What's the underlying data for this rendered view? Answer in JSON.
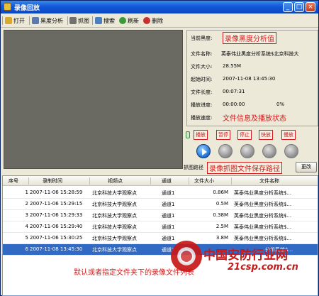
{
  "window": {
    "title": "录像回放",
    "buttons": {
      "minimize": "_",
      "maximize": "□",
      "close": "×"
    }
  },
  "toolbar": {
    "items": [
      {
        "label": "打开",
        "icon": "folder-open-icon",
        "color": "#d8a830"
      },
      {
        "label": "黑度分析",
        "icon": "chart-icon",
        "color": "#5a7ab0"
      },
      {
        "label": "抓图",
        "icon": "camera-icon",
        "color": "#707070"
      },
      {
        "label": "搜索",
        "icon": "search-icon",
        "color": "#4a80c0"
      },
      {
        "label": "刷新",
        "icon": "refresh-icon",
        "color": "#3a9a3a"
      },
      {
        "label": "删除",
        "icon": "delete-icon",
        "color": "#c83030"
      }
    ]
  },
  "info": {
    "blackness_label": "当前黑度:",
    "blackness_annotation": "录像黑度分析值",
    "file_name_label": "文件名称:",
    "file_name": "英泰伟业黑度分析系统$北京科技大",
    "file_size_label": "文件大小:",
    "file_size": "28.55M",
    "start_time_label": "起始时间:",
    "start_time": "2007-11-08 13:45:30",
    "file_length_label": "文件长度:",
    "file_length": "00:07:31",
    "progress_label": "播放进度:",
    "progress_time": "00:00:00",
    "progress_percent": "0%",
    "speed_label": "播放速度:",
    "info_annotation": "文件信息及播放状态"
  },
  "controls": {
    "labels": [
      "播放",
      "暂停",
      "停止",
      "快放",
      "慢放"
    ]
  },
  "capture_path": {
    "label": "抓图路径",
    "annotation": "录像抓图文件保存路径",
    "change_button": "更改"
  },
  "table": {
    "columns": [
      "序号",
      "录制时间",
      "视频点",
      "通道",
      "文件大小",
      "文件名称"
    ],
    "rows": [
      {
        "index": "1",
        "time": "2007-11-06 15:28:59",
        "point": "北京科技大学观察点",
        "channel": "通道1",
        "size": "0.86M",
        "name": "英泰伟业黑度分析系统$..."
      },
      {
        "index": "2",
        "time": "2007-11-06 15:29:15",
        "point": "北京科技大学观察点",
        "channel": "通道1",
        "size": "0.5M",
        "name": "英泰伟业黑度分析系统$..."
      },
      {
        "index": "3",
        "time": "2007-11-06 15:29:33",
        "point": "北京科技大学观察点",
        "channel": "通道1",
        "size": "0.38M",
        "name": "英泰伟业黑度分析系统$..."
      },
      {
        "index": "4",
        "time": "2007-11-06 15:29:40",
        "point": "北京科技大学观察点",
        "channel": "通道1",
        "size": "2.5M",
        "name": "英泰伟业黑度分析系统$..."
      },
      {
        "index": "5",
        "time": "2007-11-06 15:30:25",
        "point": "北京科技大学观察点",
        "channel": "通道1",
        "size": "3.8M",
        "name": "英泰伟业黑度分析系统$..."
      },
      {
        "index": "6",
        "time": "2007-11-08 13:45:30",
        "point": "北京科技大学观察点",
        "channel": "通道1",
        "size": "",
        "name": "分析系统$..."
      }
    ],
    "selected_row": 6,
    "list_annotation": "默认或者指定文件夹下的录像文件列表"
  },
  "watermark": {
    "title": "中国安防行业网",
    "url": "21csp.com.cn",
    "seal_color": "#c81818"
  }
}
